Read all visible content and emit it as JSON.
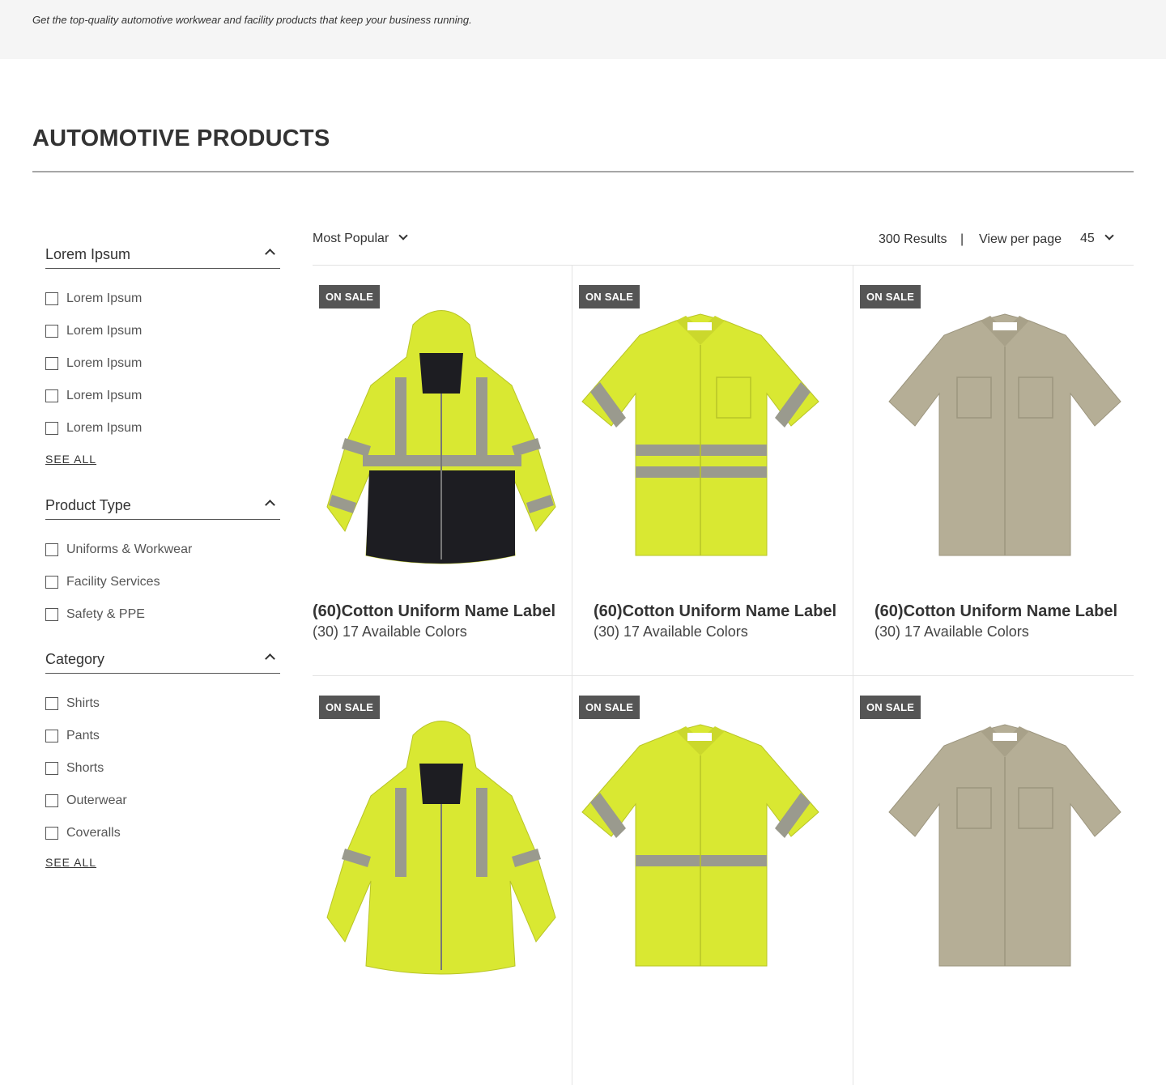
{
  "banner": {
    "text": "Get the top-quality automotive workwear and facility products that keep your business running."
  },
  "page": {
    "title": "AUTOMOTIVE PRODUCTS"
  },
  "filters": [
    {
      "title": "Lorem Ipsum",
      "options": [
        "Lorem Ipsum",
        "Lorem Ipsum",
        "Lorem Ipsum",
        "Lorem Ipsum",
        "Lorem Ipsum"
      ],
      "see_all": "SEE ALL"
    },
    {
      "title": "Product Type",
      "options": [
        "Uniforms & Workwear",
        "Facility Services",
        "Safety & PPE"
      ]
    },
    {
      "title": "Category",
      "options": [
        "Shirts",
        "Pants",
        "Shorts",
        "Outerwear",
        "Coveralls"
      ],
      "see_all": "SEE ALL"
    }
  ],
  "toolbar": {
    "sort_label": "Most Popular",
    "results": "300 Results",
    "separator": "|",
    "view_per_page_label": "View per page",
    "view_per_page_value": "45"
  },
  "products": [
    {
      "badge": "ON SALE",
      "name": "(60)Cotton Uniform Name Label",
      "colors": "(30) 17 Available Colors",
      "image": "hi-vis-jacket"
    },
    {
      "badge": "ON SALE",
      "name": "(60)Cotton Uniform Name Label",
      "colors": "(30) 17 Available Colors",
      "image": "hi-vis-shirt"
    },
    {
      "badge": "ON SALE",
      "name": "(60)Cotton Uniform Name Label",
      "colors": "(30) 17 Available Colors",
      "image": "khaki-shirt"
    },
    {
      "badge": "ON SALE",
      "image": "hi-vis-jacket"
    },
    {
      "badge": "ON SALE",
      "image": "hi-vis-shirt"
    },
    {
      "badge": "ON SALE",
      "image": "khaki-shirt"
    }
  ],
  "colors": {
    "hi_vis": "#d9e832",
    "reflective": "#9a9a8e",
    "jacket_black": "#1d1d22",
    "khaki": "#b5ae96",
    "badge_bg": "#555555"
  }
}
